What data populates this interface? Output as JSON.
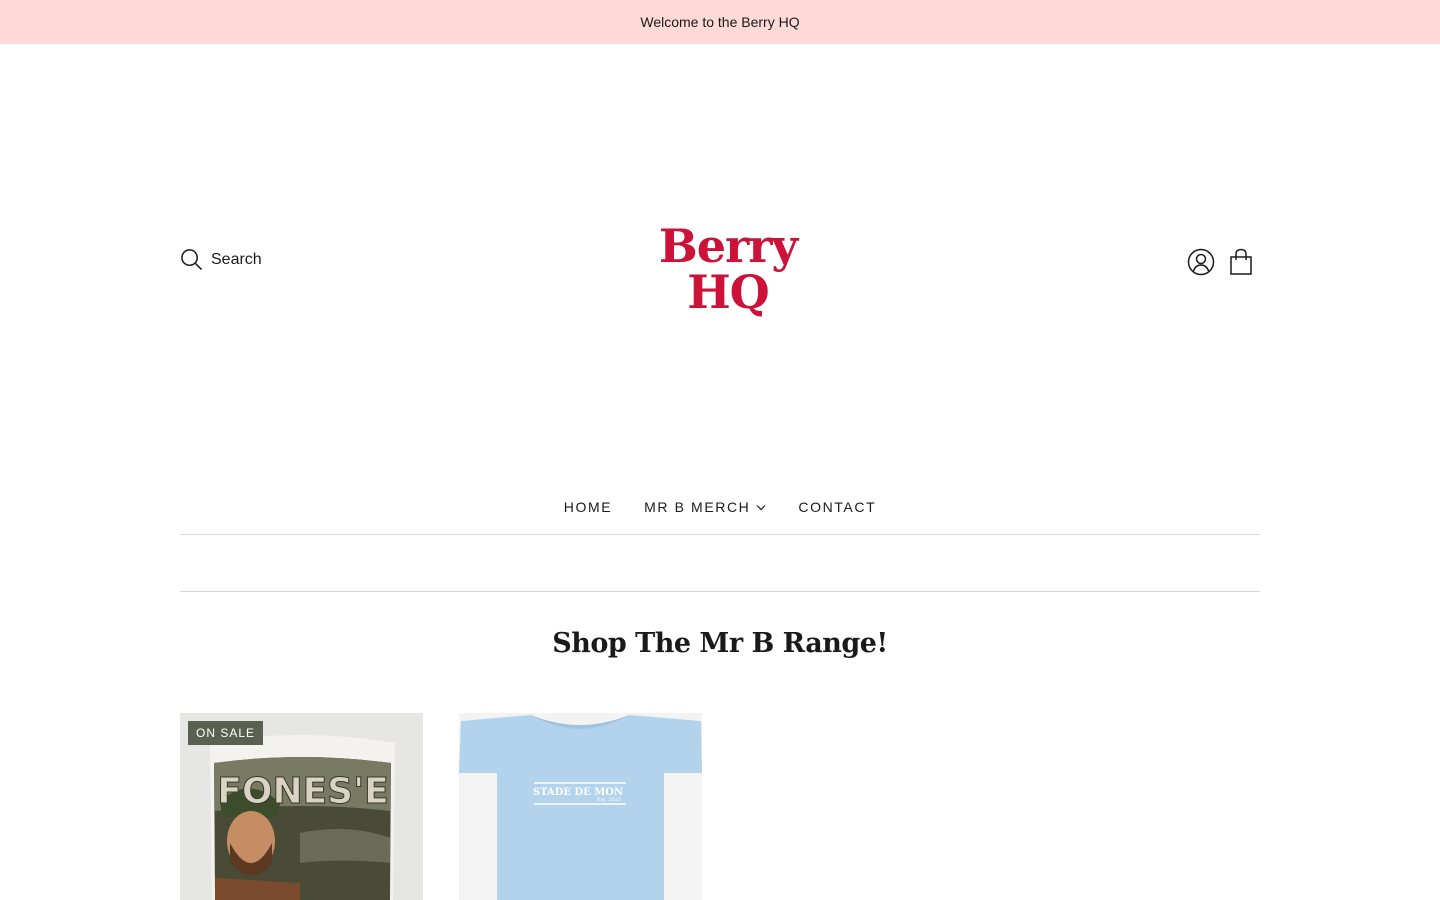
{
  "announcement": {
    "text": "Welcome to the Berry HQ"
  },
  "header": {
    "search_label": "Search",
    "logo": {
      "line1": "Berry",
      "line2": "HQ"
    },
    "account_icon": "user-circle-icon",
    "cart_icon": "shopping-bag-icon"
  },
  "nav": {
    "items": [
      {
        "label": "HOME"
      },
      {
        "label": "MR B MERCH",
        "has_dropdown": true
      },
      {
        "label": "CONTACT"
      }
    ]
  },
  "section": {
    "title": "Shop The Mr B Range!"
  },
  "products": [
    {
      "badge": "ON SALE",
      "mug_text": "FONES'E"
    },
    {
      "shirt_text": "STADE DE MON",
      "shirt_subtext": "Est. 2023"
    }
  ],
  "colors": {
    "announcement_bg": "#fddad8",
    "logo": "#cc1238",
    "badge_bg": "#5a6150"
  }
}
